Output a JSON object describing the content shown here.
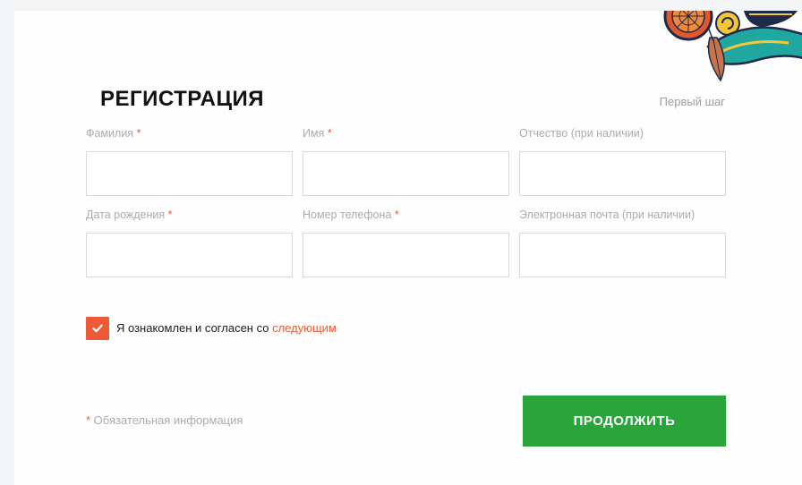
{
  "header": {
    "title": "РЕГИСТРАЦИЯ",
    "step": "Первый шаг"
  },
  "form": {
    "required_mark": "*",
    "fields": [
      {
        "label": "Фамилия",
        "required": true,
        "value": ""
      },
      {
        "label": "Имя",
        "required": true,
        "value": ""
      },
      {
        "label": "Отчество (при наличии)",
        "required": false,
        "value": ""
      },
      {
        "label": "Дата рождения",
        "required": true,
        "value": ""
      },
      {
        "label": "Номер телефона",
        "required": true,
        "value": ""
      },
      {
        "label": "Электронная почта (при наличии)",
        "required": false,
        "value": ""
      }
    ]
  },
  "agreement": {
    "checked": true,
    "text": "Я ознакомлен и согласен со ",
    "link_text": "следующим"
  },
  "footer": {
    "required_mark": "*",
    "required_note": " Обязательная информация",
    "continue_label": "ПРОДОЛЖИТЬ"
  },
  "colors": {
    "accent": "#ee5a36",
    "button": "#2aa53c",
    "required": "#e85a4b"
  }
}
